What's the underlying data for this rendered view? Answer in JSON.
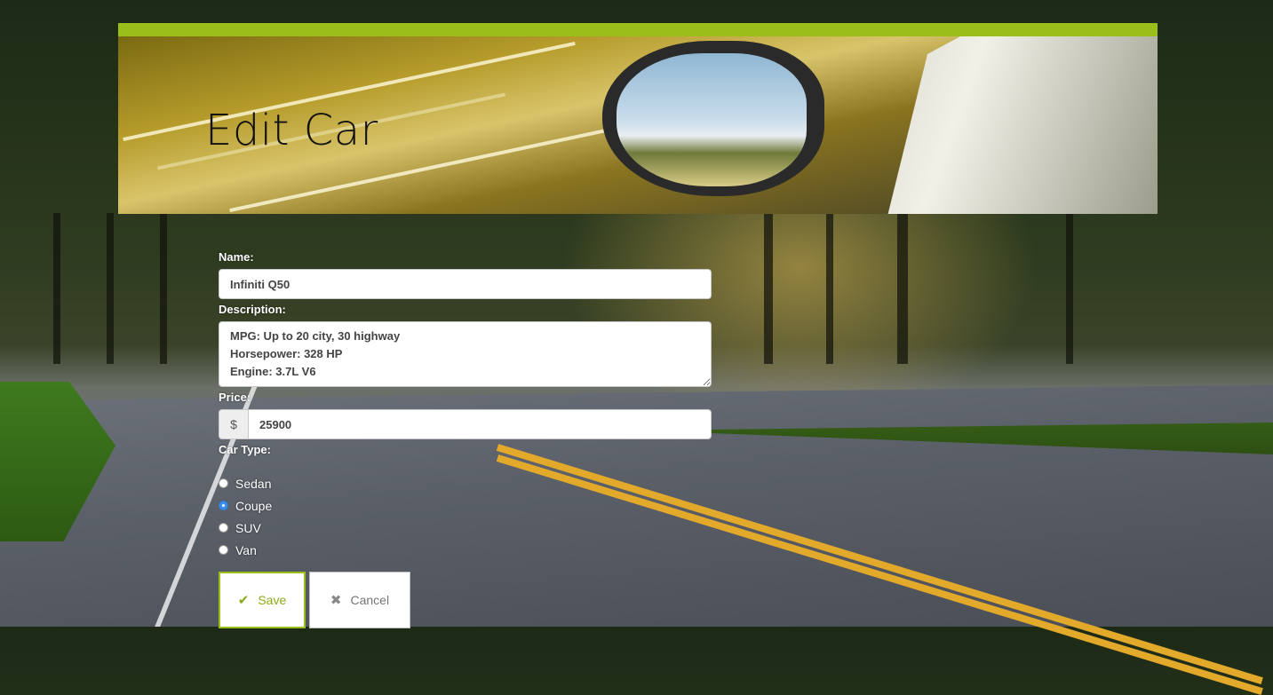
{
  "page": {
    "title": "Edit Car"
  },
  "form": {
    "name_label": "Name:",
    "name_value": "Infiniti Q50",
    "description_label": "Description:",
    "description_value": "MPG: Up to 20 city, 30 highway\nHorsepower: 328 HP\nEngine: 3.7L V6",
    "price_label": "Price:",
    "price_prefix": "$",
    "price_value": "25900",
    "car_type_label": "Car Type:",
    "car_types": [
      {
        "label": "Sedan",
        "checked": false
      },
      {
        "label": "Coupe",
        "checked": true
      },
      {
        "label": "SUV",
        "checked": false
      },
      {
        "label": "Van",
        "checked": false
      }
    ],
    "save_label": "Save",
    "save_icon": "check-icon",
    "cancel_label": "Cancel",
    "cancel_icon": "close-icon"
  },
  "colors": {
    "accent": "#9cbe1a",
    "radio_selected": "#3a8ee6"
  }
}
